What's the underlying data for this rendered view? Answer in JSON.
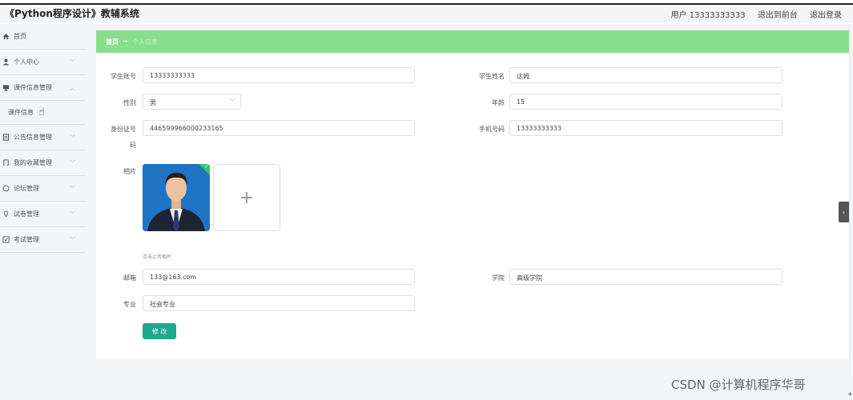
{
  "header": {
    "title": "《Python程序设计》教辅系统",
    "user": "用户 13333333333",
    "exit_front": "退出到前台",
    "logout": "退出登录"
  },
  "sidebar": {
    "items": [
      {
        "label": "首页",
        "icon": "home-icon",
        "chevron": false
      },
      {
        "label": "个人中心",
        "icon": "user-icon",
        "chevron": true
      },
      {
        "label": "课件信息管理",
        "icon": "courseware-icon",
        "chevron": true,
        "expanded": true
      },
      {
        "label": "公告信息管理",
        "icon": "notice-icon",
        "chevron": true
      },
      {
        "label": "我的收藏管理",
        "icon": "collect-icon",
        "chevron": true
      },
      {
        "label": "论坛管理",
        "icon": "forum-icon",
        "chevron": true
      },
      {
        "label": "试卷管理",
        "icon": "paper-icon",
        "chevron": true
      },
      {
        "label": "考试管理",
        "icon": "exam-icon",
        "chevron": true
      }
    ],
    "sub_item": "课件信息"
  },
  "breadcrumb": {
    "home": "首页",
    "arrow": "→",
    "current": "个人信息"
  },
  "form": {
    "student_account_label": "学生账号",
    "student_account": "13333333333",
    "student_name_label": "学生姓名",
    "student_name": "达姆",
    "gender_label": "性别",
    "gender": "男",
    "age_label": "年龄",
    "age": "15",
    "id_label_1": "身份证号",
    "id_label_2": "码",
    "id_number": "446599966000233165",
    "phone_label": "手机号码",
    "phone": "13333333333",
    "photo_label": "相片",
    "upload_plus": "+",
    "upload_hint": "点击上传相片",
    "email_label": "邮箱",
    "email": "133@163.com",
    "college_label": "学院",
    "college": "高级学院",
    "major_label": "专业",
    "major": "社会专业",
    "submit": "修 改"
  },
  "watermark": "CSDN @计算机程序华哥",
  "colors": {
    "breadcrumb_bg": "#88e08c",
    "primary_button": "#1ea78f",
    "sidebar_bg": "#f4f5f7"
  }
}
